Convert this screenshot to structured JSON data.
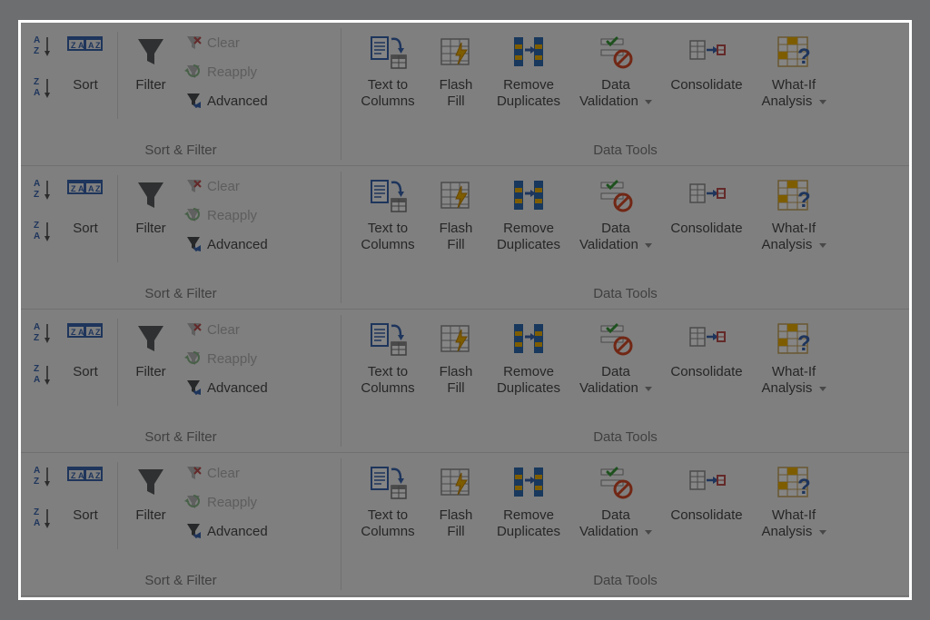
{
  "groups": {
    "sort_filter": {
      "title": "Sort & Filter",
      "sort": "Sort",
      "filter": "Filter",
      "clear": "Clear",
      "reapply": "Reapply",
      "advanced": "Advanced"
    },
    "data_tools": {
      "title": "Data Tools",
      "text_to_columns": "Text to\nColumns",
      "flash_fill": "Flash\nFill",
      "remove_duplicates": "Remove\nDuplicates",
      "data_validation": "Data\nValidation",
      "consolidate": "Consolidate",
      "what_if": "What-If\nAnalysis"
    }
  },
  "repeat_rows": 4
}
